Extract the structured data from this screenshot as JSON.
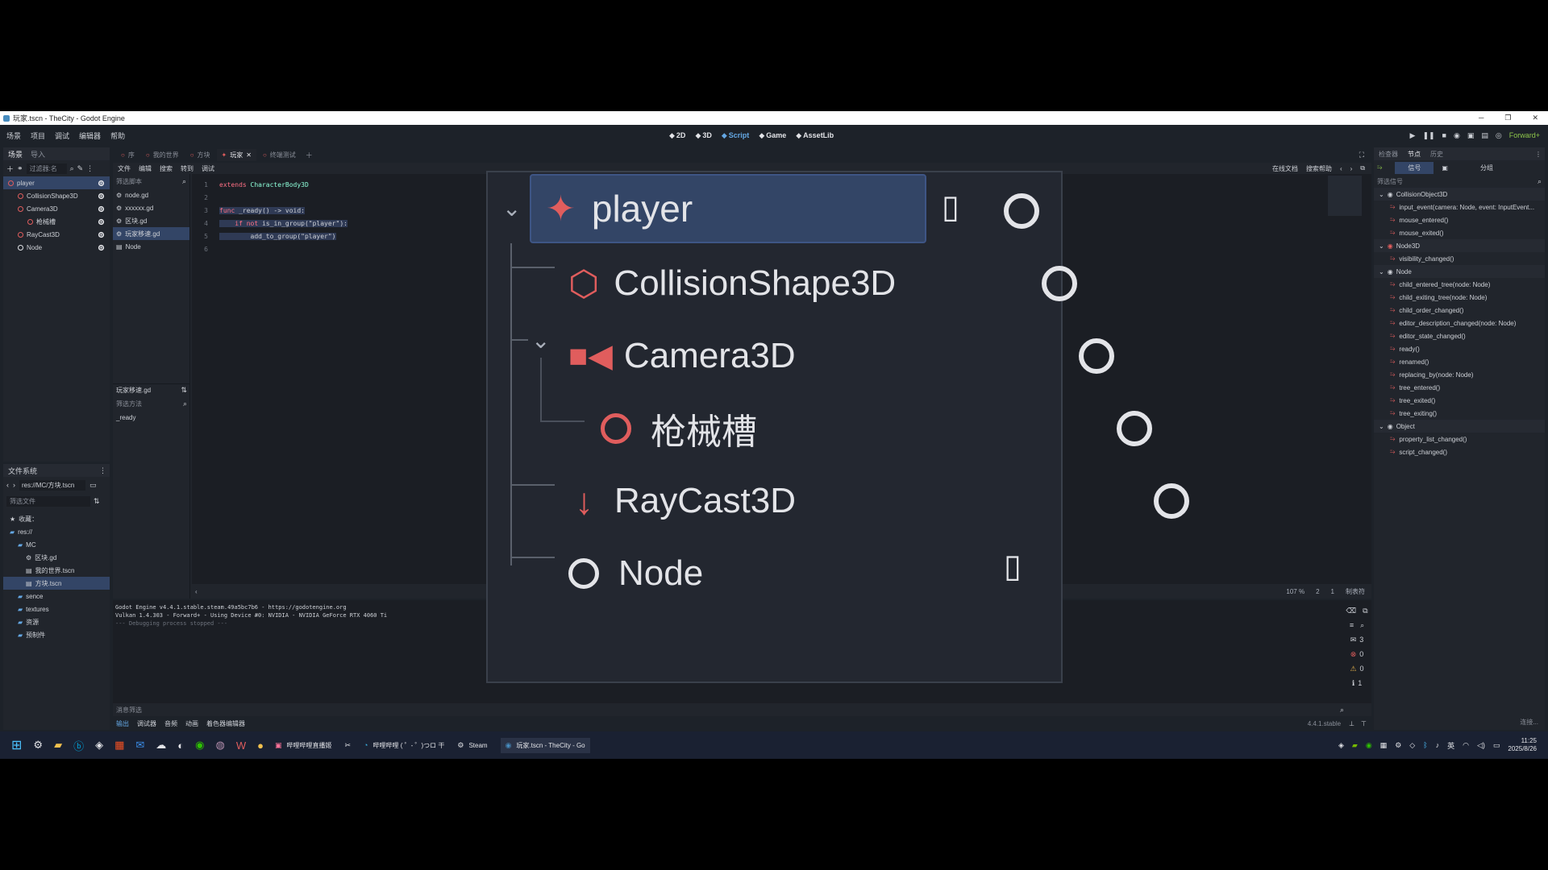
{
  "window": {
    "title": "玩家.tscn - TheCity - Godot Engine"
  },
  "menu": [
    "场景",
    "项目",
    "调试",
    "编辑器",
    "帮助"
  ],
  "workspaces": [
    {
      "label": "2D",
      "icon": "2d-icon"
    },
    {
      "label": "3D",
      "icon": "3d-icon"
    },
    {
      "label": "Script",
      "icon": "script-icon"
    },
    {
      "label": "Game",
      "icon": "game-icon"
    },
    {
      "label": "AssetLib",
      "icon": "assetlib-icon"
    }
  ],
  "renderer": "Forward+",
  "scene_dock": {
    "tabs": [
      "场景",
      "导入"
    ],
    "filter_placeholder": "过滤器:名",
    "nodes": [
      {
        "label": "player",
        "color": "#e05d5d"
      },
      {
        "label": "CollisionShape3D",
        "color": "#e05d5d"
      },
      {
        "label": "Camera3D",
        "color": "#e05d5d"
      },
      {
        "label": "枪械槽",
        "color": "#e05d5d"
      },
      {
        "label": "RayCast3D",
        "color": "#e05d5d"
      },
      {
        "label": "Node",
        "color": "#e3e4e8"
      }
    ]
  },
  "scene_tabs": [
    "序",
    "我的世界",
    "方块",
    "玩家",
    "终端测试"
  ],
  "script_menu": [
    "文件",
    "编辑",
    "搜索",
    "转到",
    "调试"
  ],
  "script_list": {
    "filter_placeholder": "筛选脚本",
    "items": [
      "node.gd",
      "xxxxxx.gd",
      "区块.gd",
      "玩家移速.gd",
      "Node"
    ],
    "current": "玩家移速.gd",
    "methods_filter_placeholder": "筛选方法",
    "methods": [
      "_ready"
    ]
  },
  "script_toolbar": {
    "online_docs": "在线文档",
    "search_help": "搜索帮助"
  },
  "code": {
    "line_numbers": [
      "1",
      "2",
      "3",
      "4",
      "5",
      "6"
    ],
    "lines": [
      {
        "kw": "extends",
        "rest": " CharacterBody3D"
      },
      {
        "kw": "",
        "rest": ""
      },
      {
        "kw": "func",
        "rest": " _ready() -> void:"
      },
      {
        "kw": "    if not",
        "rest": " is_in_group(\"player\"):"
      },
      {
        "kw": "",
        "rest": "        add_to_group(\"player\")"
      },
      {
        "kw": "",
        "rest": ""
      }
    ]
  },
  "status": {
    "zoom": "107 %",
    "line": "2",
    "col": "1",
    "indent": "制表符"
  },
  "output": {
    "lines": [
      "Godot Engine v4.4.1.stable.steam.49a5bc7b6 - https://godotengine.org",
      "Vulkan 1.4.303 - Forward+ - Using Device #0: NVIDIA - NVIDIA GeForce RTX 4060 Ti",
      "--- Debugging process stopped ---"
    ],
    "filter_placeholder": "消息筛选",
    "counts": [
      "3",
      "0",
      "0",
      "1"
    ]
  },
  "bottom_tabs": [
    "输出",
    "调试器",
    "音频",
    "动画",
    "着色器编辑器"
  ],
  "version": "4.4.1.stable",
  "filesystem": {
    "title": "文件系统",
    "path": "res://MC/方块.tscn",
    "filter_placeholder": "筛选文件",
    "items": [
      {
        "label": "收藏：",
        "indent": 0,
        "kind": "star"
      },
      {
        "label": "res://",
        "indent": 0,
        "kind": "folder"
      },
      {
        "label": "MC",
        "indent": 1,
        "kind": "folder"
      },
      {
        "label": "区块.gd",
        "indent": 2,
        "kind": "gear"
      },
      {
        "label": "我的世界.tscn",
        "indent": 2,
        "kind": "scene"
      },
      {
        "label": "方块.tscn",
        "indent": 2,
        "kind": "scene"
      },
      {
        "label": "sence",
        "indent": 1,
        "kind": "folder"
      },
      {
        "label": "textures",
        "indent": 1,
        "kind": "folder"
      },
      {
        "label": "资源",
        "indent": 1,
        "kind": "folder"
      },
      {
        "label": "预制件",
        "indent": 1,
        "kind": "folder"
      }
    ]
  },
  "inspector": {
    "tabs": [
      "检查器",
      "节点",
      "历史"
    ],
    "subtabs": [
      "信号",
      "分组"
    ],
    "filter_placeholder": "筛选信号",
    "groups": [
      {
        "name": "CollisionObject3D",
        "signals": [
          "input_event(camera: Node, event: InputEvent...",
          "mouse_entered()",
          "mouse_exited()"
        ]
      },
      {
        "name": "Node3D",
        "signals": [
          "visibility_changed()"
        ]
      },
      {
        "name": "Node",
        "signals": [
          "child_entered_tree(node: Node)",
          "child_exiting_tree(node: Node)",
          "child_order_changed()",
          "editor_description_changed(node: Node)",
          "editor_state_changed()",
          "ready()",
          "renamed()",
          "replacing_by(node: Node)",
          "tree_entered()",
          "tree_exited()",
          "tree_exiting()"
        ]
      },
      {
        "name": "Object",
        "signals": [
          "property_list_changed()",
          "script_changed()"
        ]
      }
    ],
    "connect_label": "连接..."
  },
  "zoom_overlay": {
    "nodes": [
      {
        "label": "player"
      },
      {
        "label": "CollisionShape3D"
      },
      {
        "label": "Camera3D"
      },
      {
        "label": "枪械槽"
      },
      {
        "label": "RayCast3D"
      },
      {
        "label": "Node"
      }
    ]
  },
  "taskbar": {
    "items": [
      "哔哩哔哩直播姬",
      "哔哩哔哩 ( ゜- ゜)つロ 干",
      "Steam",
      "玩家.tscn - TheCity - Go"
    ],
    "ime": "英",
    "time": "11:25",
    "date": "2025/8/26"
  }
}
